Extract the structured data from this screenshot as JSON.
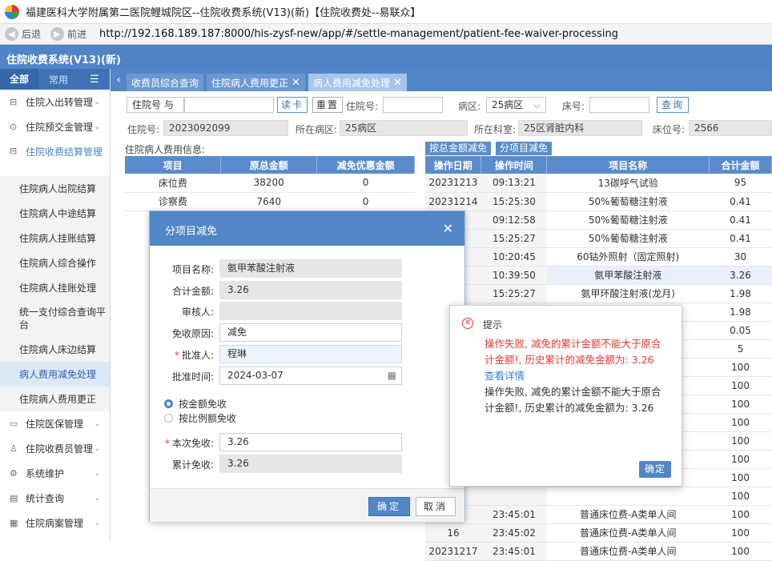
{
  "window": {
    "title": "福建医科大学附属第二医院鲤城院区--住院收费系统(V13)(新)【住院收费处--易联众】"
  },
  "browser": {
    "back": "后退",
    "forward": "前进",
    "url": "http://192.168.189.187:8000/his-zysf-new/app/#/settle-management/patient-fee-waiver-processing"
  },
  "app": {
    "name": "住院收费系统(V13)(新)"
  },
  "sidebar": {
    "tab_all": "全部",
    "tab_common": "常用",
    "menus": [
      {
        "label": "住院入出转管理",
        "icon": "transfer-icon"
      },
      {
        "label": "住院预交金管理",
        "icon": "coin-icon"
      },
      {
        "label": "住院收费结算管理",
        "icon": "settle-icon"
      }
    ],
    "subitems": [
      "住院病人出院结算",
      "住院病人中途结算",
      "住院病人挂账结算",
      "住院病人综合操作",
      "住院病人挂账处理",
      "统一支付综合查询平台",
      "住院病人床边结算",
      "病人费用减免处理",
      "住院病人费用更正"
    ],
    "menus2": [
      {
        "label": "住院医保管理",
        "icon": "card-icon"
      },
      {
        "label": "住院收费员管理",
        "icon": "user-icon"
      },
      {
        "label": "系统维护",
        "icon": "gear-icon"
      },
      {
        "label": "统计查询",
        "icon": "chart-icon"
      },
      {
        "label": "住院病案管理",
        "icon": "record-icon"
      }
    ]
  },
  "tabs": [
    "收费员综合查询",
    "住院病人费用更正",
    "病人费用减免处理"
  ],
  "search": {
    "type_label": "住院号",
    "type_caret": "与",
    "read_card": "读卡",
    "reset": "重置",
    "inpatient_no_label": "住院号:",
    "ward_label": "病区:",
    "ward_value": "25病区",
    "bed_label": "床号:",
    "query": "查询"
  },
  "info": {
    "inpatient_no_label": "住院号:",
    "inpatient_no": "2023092099",
    "ward_label": "所在病区:",
    "ward": "25病区",
    "dept_label": "所在科室:",
    "dept": "25区肾脏内科",
    "bed_label": "床位号:",
    "bed": "2566"
  },
  "left_grid": {
    "title": "住院病人费用信息:",
    "headers": [
      "项目",
      "原总金额",
      "减免优惠金额"
    ],
    "rows": [
      [
        "床位费",
        "38200",
        "0"
      ],
      [
        "诊察费",
        "7640",
        "0"
      ]
    ]
  },
  "right_buttons": {
    "by_total": "按总金额减免",
    "by_item": "分项目减免"
  },
  "right_grid": {
    "headers": [
      "操作日期",
      "操作时间",
      "项目名称",
      "合计金额"
    ],
    "rows": [
      [
        "20231213",
        "09:13:21",
        "13碳呼气试验",
        "95"
      ],
      [
        "20231214",
        "15:25:30",
        "50%葡萄糖注射液",
        "0.41"
      ],
      [
        "13",
        "09:12:58",
        "50%葡萄糖注射液",
        "0.41"
      ],
      [
        "14",
        "15:25:27",
        "50%葡萄糖注射液",
        "0.41"
      ],
      [
        "13",
        "10:20:45",
        "60钴外照射（固定照射)",
        "30"
      ],
      [
        "13",
        "10:39:50",
        "氨甲苯酸注射液",
        "3.26"
      ],
      [
        "14",
        "15:25:27",
        "氨甲环酸注射液(龙月)",
        "1.98"
      ],
      [
        "",
        "",
        "",
        "1.98"
      ],
      [
        "",
        "",
        "",
        "0.05"
      ],
      [
        "",
        "",
        "",
        "5"
      ],
      [
        "",
        "",
        "",
        "100"
      ],
      [
        "",
        "",
        "",
        "100"
      ],
      [
        "",
        "",
        "",
        "100"
      ],
      [
        "",
        "",
        "",
        "100"
      ],
      [
        "",
        "",
        "",
        "100"
      ],
      [
        "",
        "",
        "",
        "100"
      ],
      [
        "",
        "",
        "",
        "100"
      ],
      [
        "",
        "",
        "",
        "100"
      ],
      [
        "14",
        "23:45:01",
        "普通床位费-A类单人间",
        "100"
      ],
      [
        "16",
        "23:45:02",
        "普通床位费-A类单人间",
        "100"
      ],
      [
        "20231217",
        "23:45:01",
        "普通床位费-A类单人间",
        "100"
      ]
    ]
  },
  "modal": {
    "title": "分项目减免",
    "item_label": "项目名称:",
    "item_value": "氨甲苯酸注射液",
    "total_label": "合计金额:",
    "total_value": "3.26",
    "reviewer_label": "审核人:",
    "reviewer_value": "",
    "reason_label": "免收原因:",
    "reason_value": "减免",
    "approver_label": "批准人:",
    "approver_value": "程琳",
    "approve_time_label": "批准时间:",
    "approve_time_value": "2024-03-07",
    "radio1": "按金额免收",
    "radio2": "按比例额免收",
    "this_label": "本次免收:",
    "this_value": "3.26",
    "cum_label": "累计免收:",
    "cum_value": "3.26",
    "ok": "确定",
    "cancel": "取消"
  },
  "alert": {
    "title": "提示",
    "error": "操作失败, 减免的累计金额不能大于原合计金额!, 历史累计的减免金额为: 3.26",
    "detail_link": "查看详情",
    "detail": "操作失败, 减免的累计金额不能大于原合计金额!, 历史累计的减免金额为: 3.26",
    "ok": "确定"
  }
}
